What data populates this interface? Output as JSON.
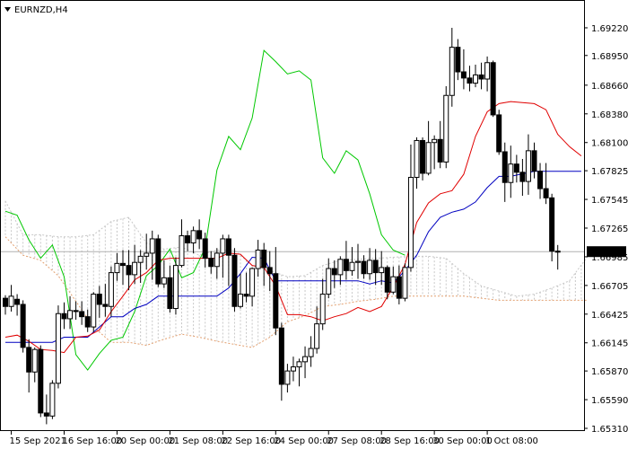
{
  "window": {
    "symbol_timeframe": "EURNZD,H4",
    "current_price_label": "1.67035"
  },
  "colors": {
    "background": "#ffffff",
    "tenkan": "#e00000",
    "kijun": "#0000c0",
    "chikou": "#00c800",
    "cloud_bull": "#c8c8c8",
    "cloud_bear": "#e3a070",
    "axis": "#000000",
    "current_line": "#b0b0b0"
  },
  "chart_data": {
    "type": "candlestick",
    "title": "EURNZD,H4",
    "indicator": "Ichimoku Kinko Hyo",
    "ylim": [
      1.6531,
      1.6936
    ],
    "y_ticks": [
      "1.69220",
      "1.68950",
      "1.68660",
      "1.68380",
      "1.68100",
      "1.67825",
      "1.67545",
      "1.67265",
      "1.66985",
      "1.66705",
      "1.66425",
      "1.66145",
      "1.65870",
      "1.65590",
      "1.65310"
    ],
    "x_ticks": [
      {
        "label": "15 Sep 2021",
        "bar": 1
      },
      {
        "label": "16 Sep 16:00",
        "bar": 10
      },
      {
        "label": "20 Sep 00:00",
        "bar": 19
      },
      {
        "label": "21 Sep 08:00",
        "bar": 28
      },
      {
        "label": "22 Sep 16:00",
        "bar": 37
      },
      {
        "label": "24 Sep 00:00",
        "bar": 46
      },
      {
        "label": "27 Sep 08:00",
        "bar": 55
      },
      {
        "label": "28 Sep 16:00",
        "bar": 64
      },
      {
        "label": "30 Sep 00:00",
        "bar": 73
      },
      {
        "label": "1 Oct 08:00",
        "bar": 82
      }
    ],
    "current_price": 1.67035,
    "candles": [
      [
        1.6658,
        1.665,
        1.6642,
        1.6661
      ],
      [
        1.665,
        1.666,
        1.6645,
        1.6671
      ],
      [
        1.6657,
        1.6652,
        1.6641,
        1.6662
      ],
      [
        1.6652,
        1.661,
        1.6605,
        1.6656
      ],
      [
        1.661,
        1.6586,
        1.6566,
        1.6618
      ],
      [
        1.6586,
        1.6608,
        1.6576,
        1.661
      ],
      [
        1.6608,
        1.6546,
        1.6542,
        1.6612
      ],
      [
        1.6546,
        1.6543,
        1.6535,
        1.6564
      ],
      [
        1.6543,
        1.6575,
        1.654,
        1.6578
      ],
      [
        1.6575,
        1.6643,
        1.657,
        1.6651
      ],
      [
        1.6643,
        1.6638,
        1.6628,
        1.6654
      ],
      [
        1.6638,
        1.6646,
        1.6628,
        1.666
      ],
      [
        1.6646,
        1.6645,
        1.6637,
        1.6655
      ],
      [
        1.6645,
        1.664,
        1.6632,
        1.6655
      ],
      [
        1.664,
        1.663,
        1.6625,
        1.6647
      ],
      [
        1.663,
        1.6662,
        1.6625,
        1.6664
      ],
      [
        1.6662,
        1.6652,
        1.6639,
        1.667
      ],
      [
        1.6652,
        1.665,
        1.664,
        1.6672
      ],
      [
        1.665,
        1.6683,
        1.664,
        1.6689
      ],
      [
        1.6683,
        1.6692,
        1.6675,
        1.6702
      ],
      [
        1.6692,
        1.669,
        1.6671,
        1.6705
      ],
      [
        1.669,
        1.6681,
        1.6666,
        1.6705
      ],
      [
        1.6681,
        1.6693,
        1.6672,
        1.671
      ],
      [
        1.6693,
        1.6699,
        1.6673,
        1.6705
      ],
      [
        1.6699,
        1.6702,
        1.6686,
        1.6721
      ],
      [
        1.6702,
        1.6716,
        1.6676,
        1.6724
      ],
      [
        1.6716,
        1.6672,
        1.6669,
        1.672
      ],
      [
        1.6672,
        1.6678,
        1.6668,
        1.6695
      ],
      [
        1.6678,
        1.6648,
        1.6644,
        1.669
      ],
      [
        1.6648,
        1.669,
        1.6642,
        1.6698
      ],
      [
        1.669,
        1.6719,
        1.6688,
        1.6735
      ],
      [
        1.6719,
        1.6712,
        1.6704,
        1.6724
      ],
      [
        1.6712,
        1.6724,
        1.6702,
        1.6728
      ],
      [
        1.6724,
        1.6716,
        1.6706,
        1.6735
      ],
      [
        1.6716,
        1.6697,
        1.6688,
        1.6722
      ],
      [
        1.6697,
        1.6689,
        1.6682,
        1.6704
      ],
      [
        1.6689,
        1.6702,
        1.6677,
        1.6707
      ],
      [
        1.6702,
        1.6716,
        1.6678,
        1.672
      ],
      [
        1.6716,
        1.67,
        1.667,
        1.672
      ],
      [
        1.67,
        1.665,
        1.6645,
        1.6707
      ],
      [
        1.665,
        1.6662,
        1.6648,
        1.6682
      ],
      [
        1.6662,
        1.666,
        1.6654,
        1.6683
      ],
      [
        1.666,
        1.6687,
        1.665,
        1.6688
      ],
      [
        1.6687,
        1.6705,
        1.6679,
        1.6715
      ],
      [
        1.6705,
        1.6688,
        1.667,
        1.6712
      ],
      [
        1.6688,
        1.6682,
        1.6665,
        1.6704
      ],
      [
        1.6682,
        1.6629,
        1.6622,
        1.6708
      ],
      [
        1.6629,
        1.6574,
        1.6558,
        1.6634
      ],
      [
        1.6574,
        1.6587,
        1.6566,
        1.6594
      ],
      [
        1.6587,
        1.6591,
        1.6577,
        1.6601
      ],
      [
        1.6591,
        1.6596,
        1.6572,
        1.6599
      ],
      [
        1.6596,
        1.6601,
        1.658,
        1.6611
      ],
      [
        1.6601,
        1.6609,
        1.6591,
        1.6621
      ],
      [
        1.6609,
        1.6633,
        1.6604,
        1.665
      ],
      [
        1.6633,
        1.6662,
        1.6627,
        1.6677
      ],
      [
        1.6662,
        1.6687,
        1.6658,
        1.6697
      ],
      [
        1.6687,
        1.6681,
        1.6668,
        1.6695
      ],
      [
        1.6681,
        1.6696,
        1.6671,
        1.6699
      ],
      [
        1.6696,
        1.6685,
        1.6676,
        1.6714
      ],
      [
        1.6685,
        1.6693,
        1.668,
        1.6708
      ],
      [
        1.6693,
        1.6694,
        1.6677,
        1.6711
      ],
      [
        1.6694,
        1.6682,
        1.6677,
        1.67
      ],
      [
        1.6682,
        1.6695,
        1.6676,
        1.6707
      ],
      [
        1.6695,
        1.6683,
        1.6671,
        1.6706
      ],
      [
        1.6683,
        1.6688,
        1.6671,
        1.6704
      ],
      [
        1.6688,
        1.6664,
        1.6657,
        1.669
      ],
      [
        1.6664,
        1.6679,
        1.6662,
        1.6689
      ],
      [
        1.6679,
        1.6658,
        1.6652,
        1.669
      ],
      [
        1.6658,
        1.6688,
        1.6655,
        1.6692
      ],
      [
        1.6688,
        1.6776,
        1.6684,
        1.6808
      ],
      [
        1.6776,
        1.6812,
        1.6765,
        1.6815
      ],
      [
        1.6812,
        1.678,
        1.6773,
        1.6815
      ],
      [
        1.678,
        1.681,
        1.6778,
        1.6831
      ],
      [
        1.681,
        1.6813,
        1.6784,
        1.6817
      ],
      [
        1.6813,
        1.6791,
        1.6785,
        1.6831
      ],
      [
        1.6791,
        1.6856,
        1.6785,
        1.6865
      ],
      [
        1.6856,
        1.6903,
        1.6845,
        1.6922
      ],
      [
        1.6903,
        1.6879,
        1.6871,
        1.6911
      ],
      [
        1.6879,
        1.6873,
        1.6862,
        1.6901
      ],
      [
        1.6873,
        1.6868,
        1.686,
        1.6885
      ],
      [
        1.6868,
        1.6876,
        1.6864,
        1.6886
      ],
      [
        1.6876,
        1.6872,
        1.6862,
        1.6888
      ],
      [
        1.6872,
        1.6888,
        1.686,
        1.6894
      ],
      [
        1.6888,
        1.6837,
        1.6835,
        1.689
      ],
      [
        1.6837,
        1.6801,
        1.6798,
        1.6842
      ],
      [
        1.6801,
        1.6771,
        1.6752,
        1.681
      ],
      [
        1.6771,
        1.6789,
        1.6756,
        1.6807
      ],
      [
        1.6789,
        1.6781,
        1.6771,
        1.6798
      ],
      [
        1.6781,
        1.6772,
        1.6758,
        1.6794
      ],
      [
        1.6772,
        1.6802,
        1.6759,
        1.6818
      ],
      [
        1.6802,
        1.6782,
        1.6775,
        1.681
      ],
      [
        1.6782,
        1.6765,
        1.6755,
        1.679
      ],
      [
        1.6765,
        1.6756,
        1.675,
        1.679
      ],
      [
        1.6756,
        1.6704,
        1.6694,
        1.676
      ],
      [
        1.6704,
        1.6703,
        1.6686,
        1.671
      ]
    ],
    "tenkan": [
      [
        0,
        1.662
      ],
      [
        2,
        1.6622
      ],
      [
        4,
        1.6616
      ],
      [
        6,
        1.6608
      ],
      [
        8,
        1.6607
      ],
      [
        10,
        1.6605
      ],
      [
        12,
        1.662
      ],
      [
        14,
        1.6621
      ],
      [
        16,
        1.6627
      ],
      [
        18,
        1.6645
      ],
      [
        20,
        1.666
      ],
      [
        22,
        1.6676
      ],
      [
        24,
        1.6683
      ],
      [
        26,
        1.6695
      ],
      [
        28,
        1.6697
      ],
      [
        30,
        1.6697
      ],
      [
        32,
        1.6697
      ],
      [
        34,
        1.6697
      ],
      [
        36,
        1.6697
      ],
      [
        38,
        1.6702
      ],
      [
        40,
        1.6701
      ],
      [
        42,
        1.669
      ],
      [
        44,
        1.6688
      ],
      [
        46,
        1.667
      ],
      [
        48,
        1.6642
      ],
      [
        50,
        1.6642
      ],
      [
        52,
        1.664
      ],
      [
        54,
        1.6636
      ],
      [
        56,
        1.664
      ],
      [
        58,
        1.6643
      ],
      [
        60,
        1.6649
      ],
      [
        62,
        1.6645
      ],
      [
        64,
        1.665
      ],
      [
        66,
        1.6669
      ],
      [
        68,
        1.6691
      ],
      [
        70,
        1.6732
      ],
      [
        72,
        1.6751
      ],
      [
        74,
        1.676
      ],
      [
        76,
        1.6763
      ],
      [
        78,
        1.6779
      ],
      [
        80,
        1.6816
      ],
      [
        82,
        1.684
      ],
      [
        84,
        1.6848
      ],
      [
        86,
        1.685
      ],
      [
        88,
        1.6849
      ],
      [
        90,
        1.6848
      ],
      [
        92,
        1.6842
      ],
      [
        94,
        1.6818
      ],
      [
        96,
        1.6806
      ],
      [
        98,
        1.6797
      ]
    ],
    "kijun": [
      [
        0,
        1.6615
      ],
      [
        4,
        1.6615
      ],
      [
        8,
        1.6615
      ],
      [
        10,
        1.662
      ],
      [
        14,
        1.662
      ],
      [
        16,
        1.663
      ],
      [
        18,
        1.664
      ],
      [
        20,
        1.664
      ],
      [
        22,
        1.6648
      ],
      [
        24,
        1.6652
      ],
      [
        26,
        1.666
      ],
      [
        28,
        1.666
      ],
      [
        30,
        1.666
      ],
      [
        34,
        1.666
      ],
      [
        36,
        1.666
      ],
      [
        38,
        1.6668
      ],
      [
        40,
        1.6682
      ],
      [
        42,
        1.6698
      ],
      [
        44,
        1.6697
      ],
      [
        46,
        1.6675
      ],
      [
        48,
        1.6675
      ],
      [
        52,
        1.6675
      ],
      [
        56,
        1.6675
      ],
      [
        60,
        1.6675
      ],
      [
        62,
        1.6672
      ],
      [
        64,
        1.6675
      ],
      [
        66,
        1.6673
      ],
      [
        68,
        1.6685
      ],
      [
        70,
        1.67
      ],
      [
        72,
        1.6723
      ],
      [
        74,
        1.6737
      ],
      [
        76,
        1.6742
      ],
      [
        78,
        1.6745
      ],
      [
        80,
        1.6752
      ],
      [
        82,
        1.6766
      ],
      [
        84,
        1.6777
      ],
      [
        86,
        1.6777
      ],
      [
        90,
        1.6782
      ],
      [
        92,
        1.6782
      ],
      [
        94,
        1.6782
      ],
      [
        96,
        1.6782
      ],
      [
        98,
        1.6782
      ]
    ],
    "chikou": [
      [
        0,
        1.6743
      ],
      [
        2,
        1.6739
      ],
      [
        4,
        1.6715
      ],
      [
        6,
        1.6697
      ],
      [
        8,
        1.671
      ],
      [
        10,
        1.6679
      ],
      [
        12,
        1.6603
      ],
      [
        14,
        1.6588
      ],
      [
        16,
        1.6604
      ],
      [
        18,
        1.6617
      ],
      [
        20,
        1.662
      ],
      [
        22,
        1.6645
      ],
      [
        24,
        1.668
      ],
      [
        26,
        1.669
      ],
      [
        28,
        1.6706
      ],
      [
        30,
        1.6678
      ],
      [
        32,
        1.6683
      ],
      [
        34,
        1.6707
      ],
      [
        36,
        1.6783
      ],
      [
        38,
        1.6816
      ],
      [
        40,
        1.6803
      ],
      [
        42,
        1.6834
      ],
      [
        44,
        1.69
      ],
      [
        46,
        1.6889
      ],
      [
        48,
        1.6877
      ],
      [
        50,
        1.688
      ],
      [
        52,
        1.6871
      ],
      [
        54,
        1.6795
      ],
      [
        56,
        1.678
      ],
      [
        58,
        1.6802
      ],
      [
        60,
        1.6793
      ],
      [
        62,
        1.676
      ],
      [
        64,
        1.672
      ],
      [
        66,
        1.6705
      ],
      [
        68,
        1.67
      ]
    ],
    "span_a": [
      [
        0,
        1.6753
      ],
      [
        3,
        1.672
      ],
      [
        6,
        1.672
      ],
      [
        9,
        1.6718
      ],
      [
        12,
        1.6718
      ],
      [
        15,
        1.672
      ],
      [
        18,
        1.6733
      ],
      [
        21,
        1.6737
      ],
      [
        24,
        1.6712
      ],
      [
        27,
        1.6706
      ],
      [
        30,
        1.6708
      ],
      [
        33,
        1.67
      ],
      [
        36,
        1.6705
      ],
      [
        39,
        1.6705
      ],
      [
        42,
        1.669
      ],
      [
        45,
        1.6685
      ],
      [
        48,
        1.6679
      ],
      [
        51,
        1.668
      ],
      [
        54,
        1.669
      ],
      [
        57,
        1.6695
      ],
      [
        60,
        1.6696
      ],
      [
        63,
        1.6697
      ],
      [
        66,
        1.6698
      ],
      [
        69,
        1.6699
      ],
      [
        72,
        1.6699
      ],
      [
        75,
        1.6697
      ],
      [
        78,
        1.6682
      ],
      [
        81,
        1.667
      ],
      [
        84,
        1.6665
      ],
      [
        87,
        1.666
      ],
      [
        90,
        1.6662
      ],
      [
        93,
        1.6668
      ],
      [
        96,
        1.6675
      ],
      [
        99,
        1.6698
      ]
    ],
    "span_b": [
      [
        0,
        1.6718
      ],
      [
        3,
        1.67
      ],
      [
        6,
        1.6695
      ],
      [
        9,
        1.668
      ],
      [
        12,
        1.6655
      ],
      [
        15,
        1.663
      ],
      [
        18,
        1.6615
      ],
      [
        21,
        1.6615
      ],
      [
        24,
        1.6612
      ],
      [
        27,
        1.6618
      ],
      [
        30,
        1.6623
      ],
      [
        33,
        1.662
      ],
      [
        36,
        1.6616
      ],
      [
        39,
        1.6613
      ],
      [
        42,
        1.661
      ],
      [
        45,
        1.662
      ],
      [
        48,
        1.6635
      ],
      [
        51,
        1.6641
      ],
      [
        54,
        1.665
      ],
      [
        57,
        1.6652
      ],
      [
        60,
        1.6655
      ],
      [
        63,
        1.6657
      ],
      [
        66,
        1.666
      ],
      [
        69,
        1.666
      ],
      [
        72,
        1.666
      ],
      [
        75,
        1.666
      ],
      [
        78,
        1.666
      ],
      [
        81,
        1.6658
      ],
      [
        84,
        1.6656
      ],
      [
        87,
        1.6656
      ],
      [
        90,
        1.6656
      ],
      [
        93,
        1.6656
      ],
      [
        96,
        1.6656
      ],
      [
        99,
        1.6656
      ]
    ]
  }
}
